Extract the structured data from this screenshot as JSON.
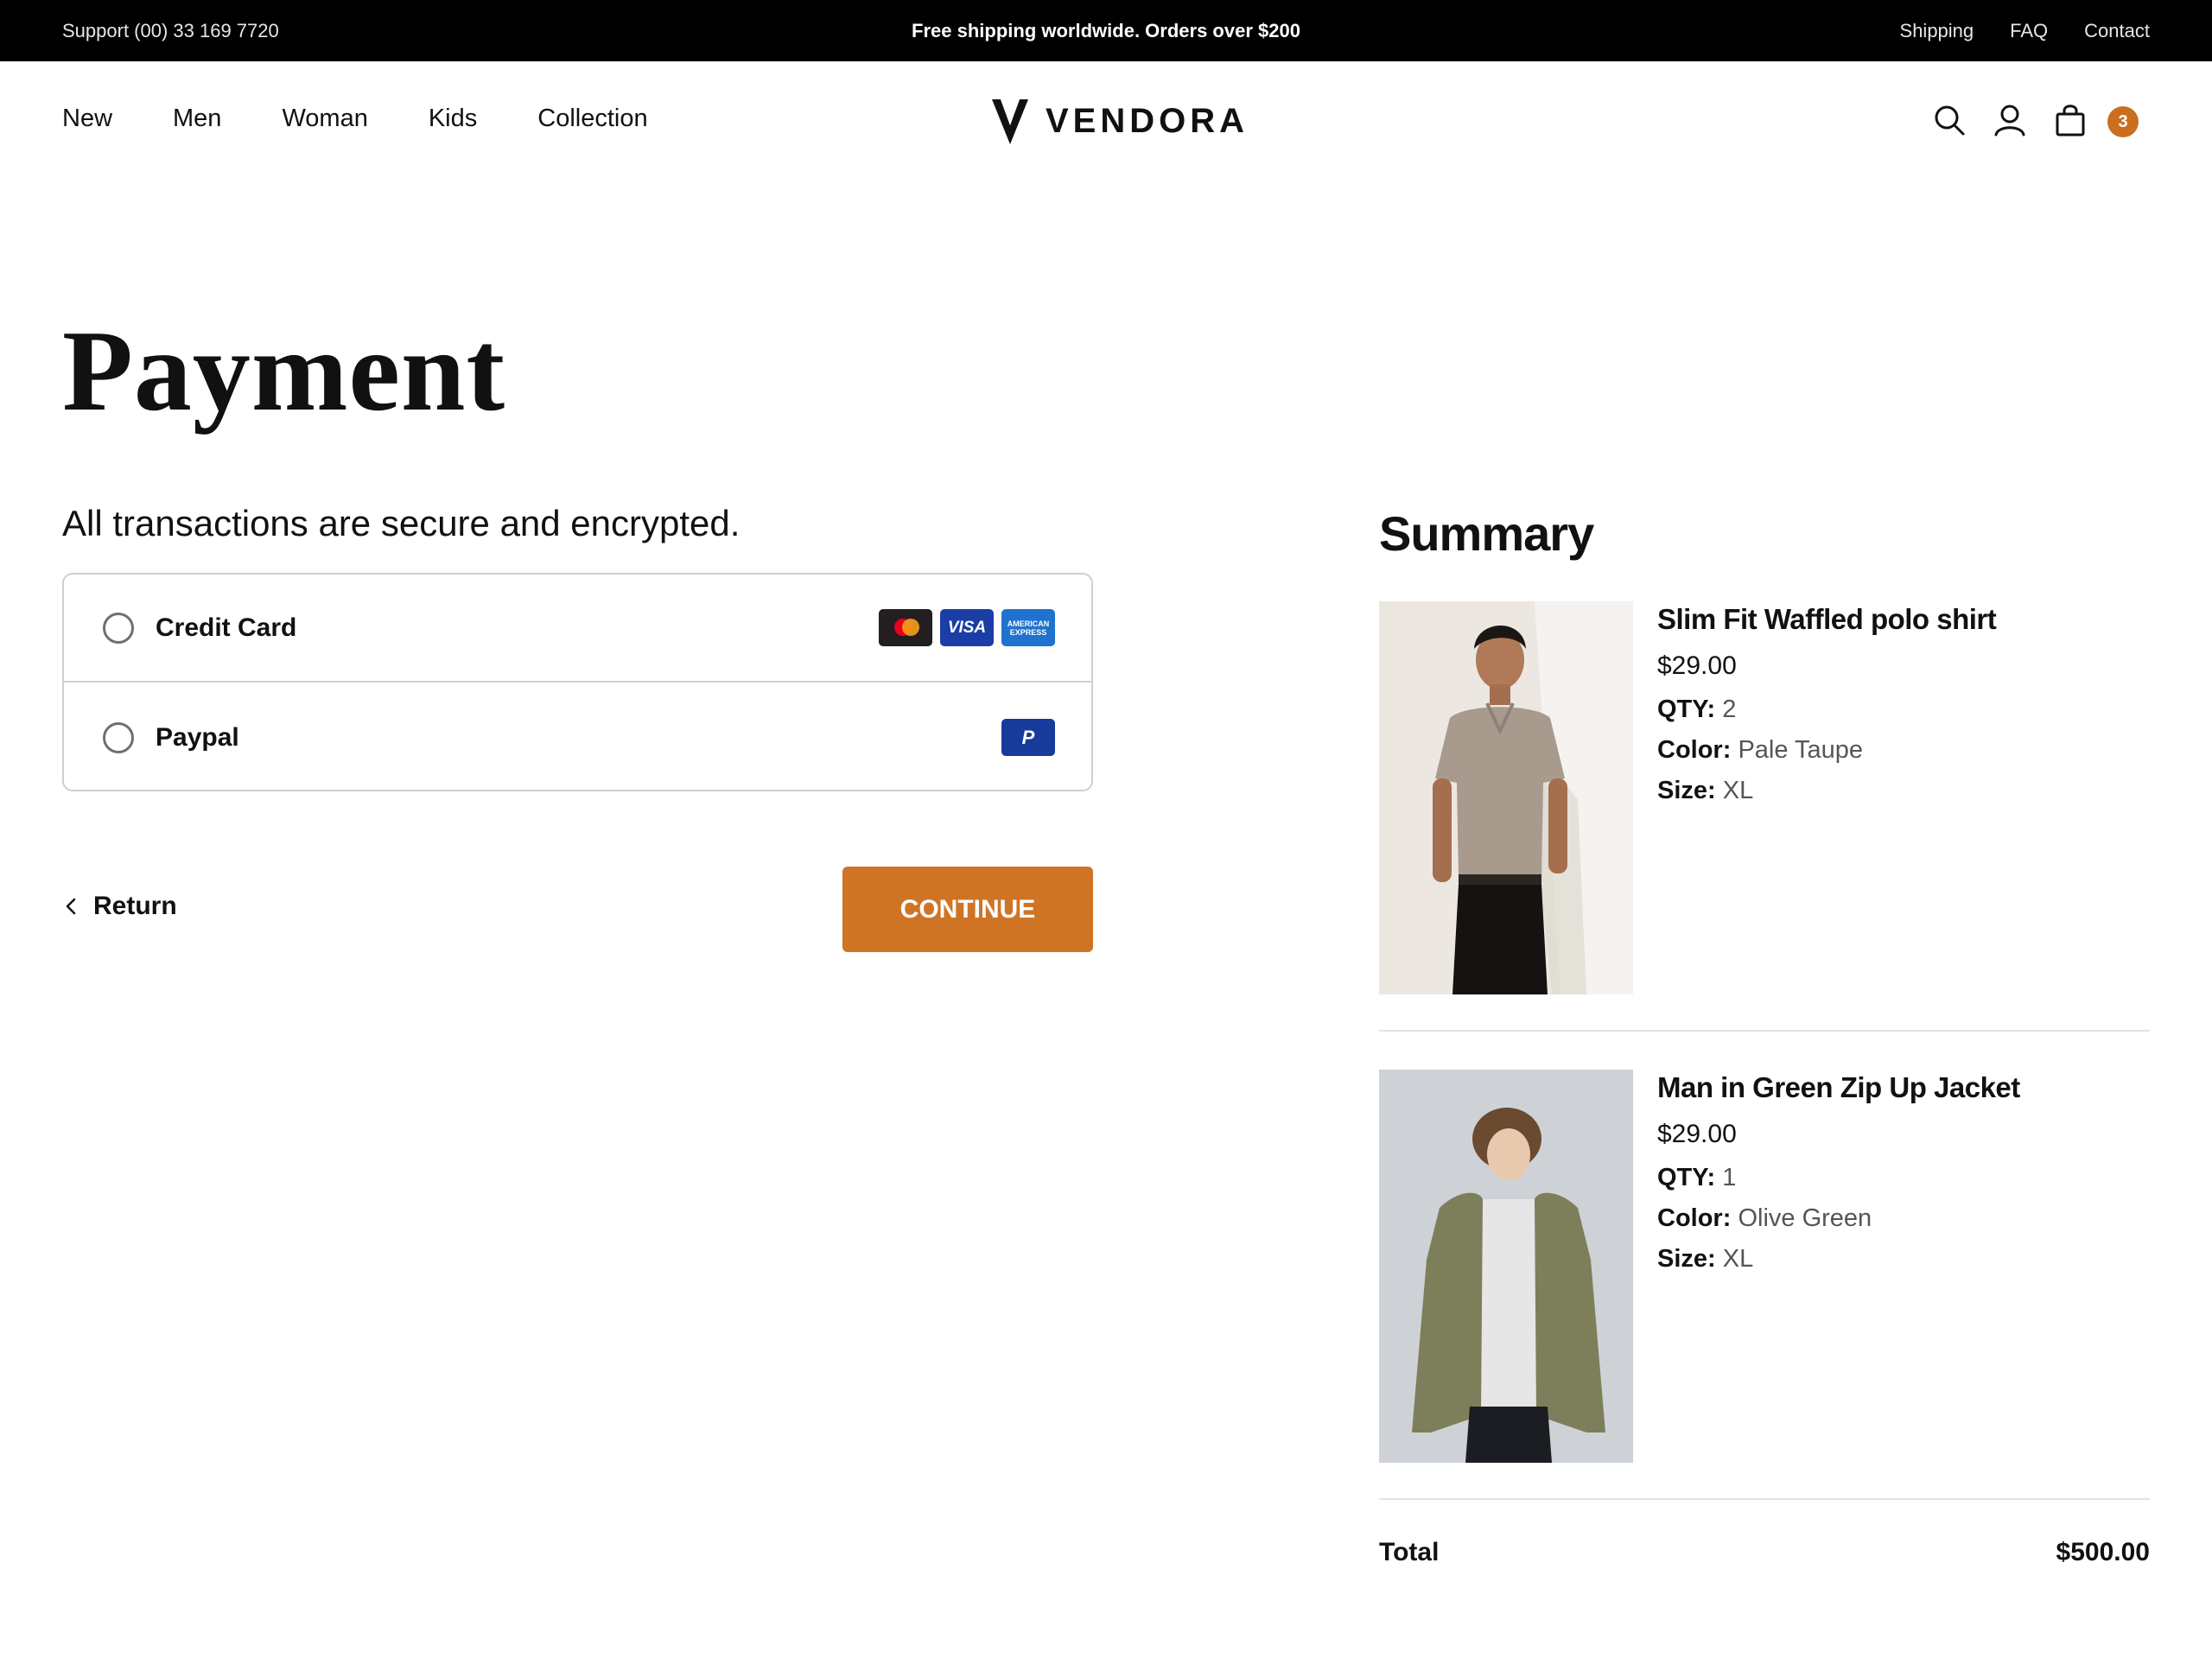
{
  "topbar": {
    "support": "Support (00) 33 169 7720",
    "promo": "Free shipping worldwide. Orders over $200",
    "links": [
      "Shipping",
      "FAQ",
      "Contact"
    ]
  },
  "nav": {
    "items": [
      "New",
      "Men",
      "Woman",
      "Kids",
      "Collection"
    ],
    "brand": "VENDORA",
    "cart_count": "3"
  },
  "payment": {
    "title": "Payment",
    "secure_note": "All transactions are secure and encrypted.",
    "methods": [
      {
        "label": "Credit Card",
        "selected": false,
        "cards": [
          "mastercard-icon",
          "visa-icon",
          "amex-icon"
        ]
      },
      {
        "label": "Paypal",
        "selected": false,
        "cards": [
          "paypal-icon"
        ]
      }
    ],
    "card_text": {
      "visa": "VISA",
      "amex": "AMERICAN EXPRESS",
      "paypal": "P"
    },
    "return_label": "Return",
    "continue_label": "CONTINUE"
  },
  "summary": {
    "title": "Summary",
    "items": [
      {
        "name": "Slim Fit Waffled polo shirt",
        "price": "$29.00",
        "qty_label": "QTY:",
        "qty": "2",
        "color_label": "Color:",
        "color": "Pale Taupe",
        "size_label": "Size:",
        "size": "XL"
      },
      {
        "name": "Man in Green Zip Up Jacket",
        "price": "$29.00",
        "qty_label": "QTY:",
        "qty": "1",
        "color_label": "Color:",
        "color": "Olive Green",
        "size_label": "Size:",
        "size": "XL"
      }
    ],
    "total_label": "Total",
    "total_value": "$500.00"
  },
  "colors": {
    "accent": "#cf7425",
    "badge": "#c96f1f",
    "topbar": "#000000"
  }
}
